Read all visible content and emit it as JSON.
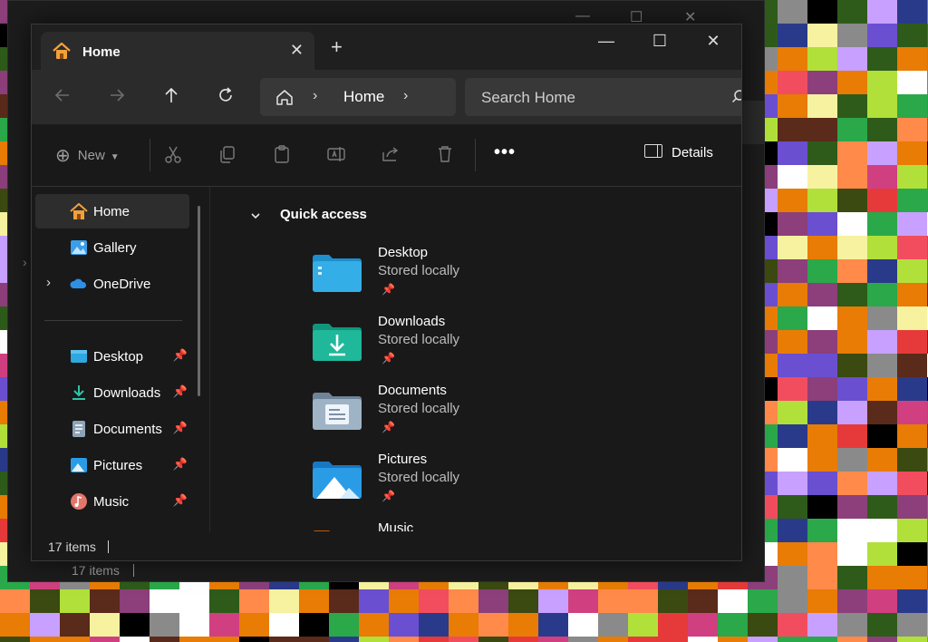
{
  "window": {
    "tab_title": "Home",
    "new_tab_symbol": "+",
    "minimize_symbol": "—",
    "maximize_symbol": "☐",
    "close_symbol": "✕"
  },
  "navigation": {
    "back_icon": "arrow-left-icon",
    "forward_icon": "arrow-right-icon",
    "up_icon": "arrow-up-icon",
    "refresh_icon": "refresh-icon",
    "breadcrumb": {
      "location": "Home"
    },
    "search": {
      "placeholder": "Search Home"
    }
  },
  "toolbar": {
    "new_label": "New",
    "more_label": "•••",
    "details_label": "Details"
  },
  "sidebar": {
    "items": [
      {
        "label": "Home",
        "icon": "home-icon",
        "active": true
      },
      {
        "label": "Gallery",
        "icon": "gallery-icon"
      },
      {
        "label": "OneDrive",
        "icon": "cloud-icon",
        "expandable": true
      }
    ],
    "pinned": [
      {
        "label": "Desktop",
        "icon": "desktop-folder-icon"
      },
      {
        "label": "Downloads",
        "icon": "download-icon"
      },
      {
        "label": "Documents",
        "icon": "documents-icon"
      },
      {
        "label": "Pictures",
        "icon": "pictures-icon"
      },
      {
        "label": "Music",
        "icon": "music-icon"
      }
    ]
  },
  "content": {
    "section_title": "Quick access",
    "items": [
      {
        "name": "Desktop",
        "status": "Stored locally",
        "color": "#2fa7e0"
      },
      {
        "name": "Downloads",
        "status": "Stored locally",
        "color": "#1fb89a"
      },
      {
        "name": "Documents",
        "status": "Stored locally",
        "color": "#8ea3b8"
      },
      {
        "name": "Pictures",
        "status": "Stored locally",
        "color": "#2a9ce6"
      },
      {
        "name": "Music",
        "status": "",
        "color": "#e07a2a"
      }
    ]
  },
  "status": {
    "item_count": "17 items"
  },
  "background_window": {
    "status": "17 items"
  }
}
